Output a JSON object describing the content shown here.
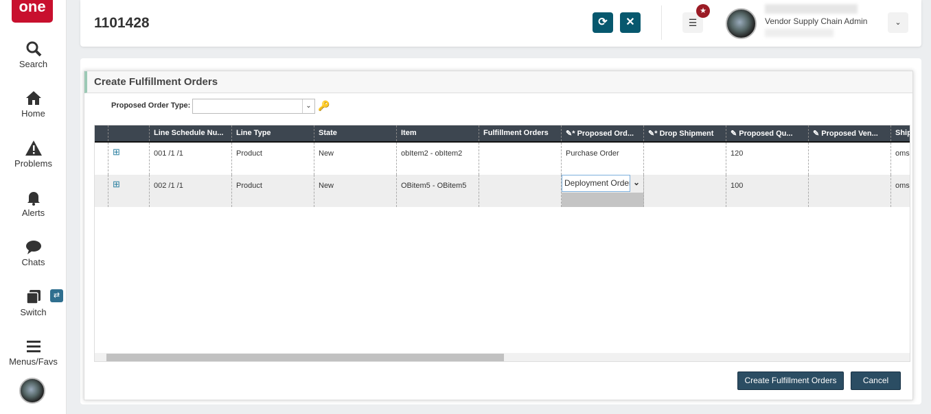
{
  "sidebar": {
    "logo": "One",
    "items": [
      {
        "label": "Search"
      },
      {
        "label": "Home"
      },
      {
        "label": "Problems"
      },
      {
        "label": "Alerts"
      },
      {
        "label": "Chats"
      },
      {
        "label": "Switch"
      },
      {
        "label": "Menus/Favs"
      }
    ]
  },
  "header": {
    "title": "1101428",
    "role": "Vendor Supply Chain Admin"
  },
  "modal": {
    "title": "Create Fulfillment Orders",
    "order_type_label": "Proposed Order Type:",
    "order_type_value": "",
    "columns": [
      "",
      "",
      "Line Schedule Nu...",
      "Line Type",
      "State",
      "Item",
      "Fulfillment Orders",
      "Proposed Ord...",
      "Drop Shipment",
      "Proposed Qu...",
      "Proposed Ven...",
      "Ship"
    ],
    "rows": [
      {
        "line": "001 /1 /1",
        "type": "Product",
        "state": "New",
        "item": "obItem2 - obItem2",
        "fo": "",
        "order": "Purchase Order",
        "drop": "",
        "qty": "120",
        "vendor": "",
        "ship": "oms"
      },
      {
        "line": "002 /1 /1",
        "type": "Product",
        "state": "New",
        "item": "OBitem5 - OBitem5",
        "fo": "",
        "order": "Deployment Order",
        "drop": "",
        "qty": "100",
        "vendor": "",
        "ship": "oms"
      }
    ],
    "create_label": "Create Fulfillment Orders",
    "cancel_label": "Cancel"
  },
  "colors": {
    "accent": "#07586e",
    "header": "#3d4650",
    "logo": "#c8102e"
  }
}
